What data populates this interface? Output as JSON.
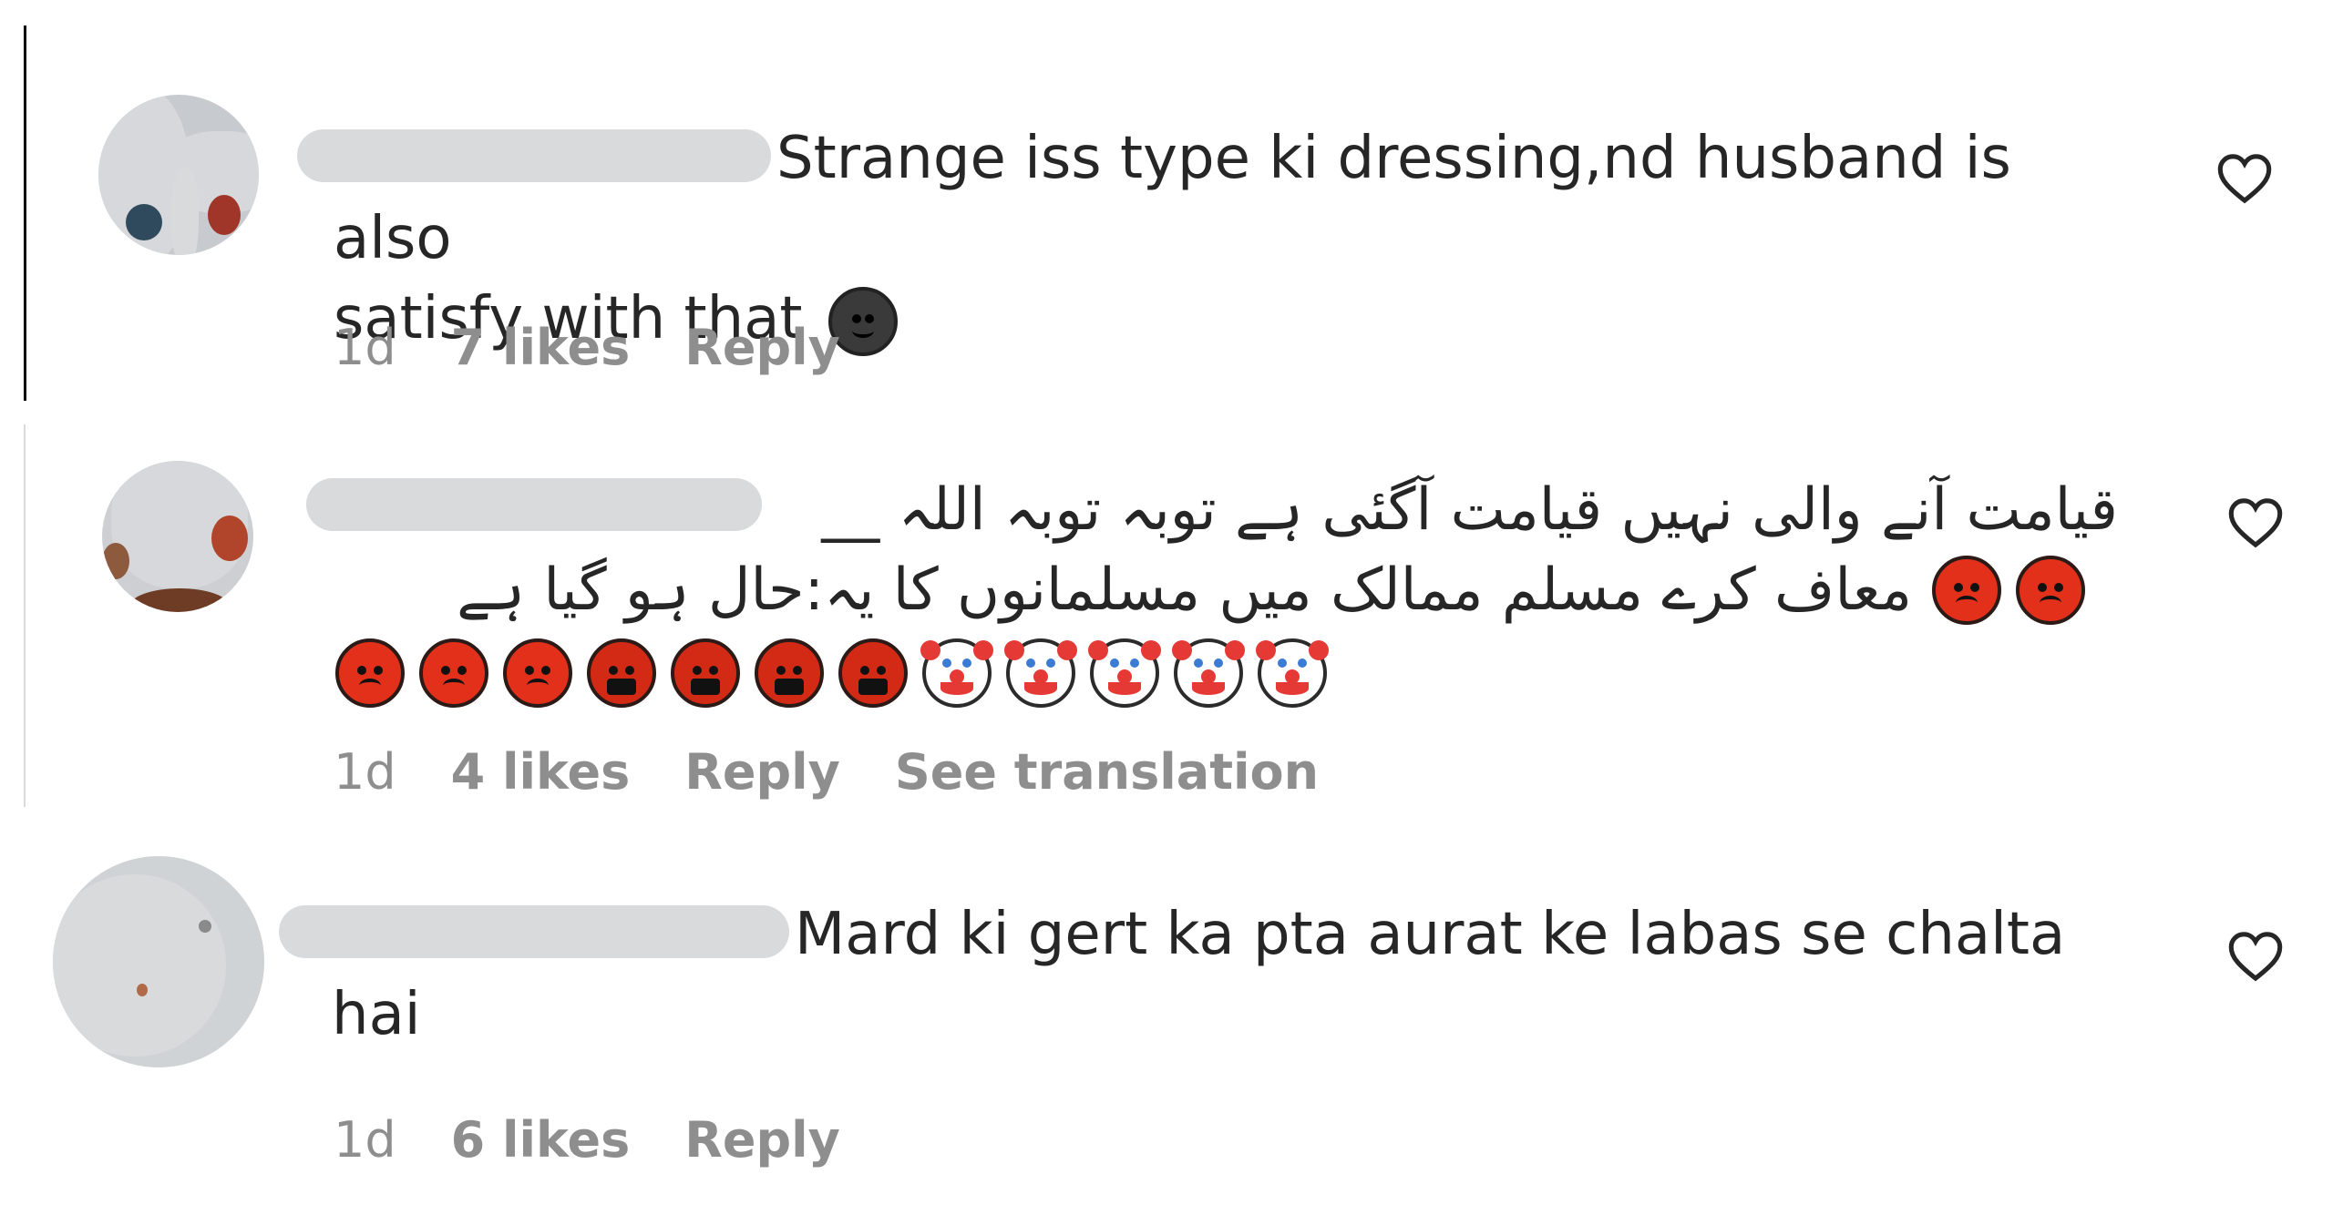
{
  "comments": [
    {
      "text": "Strange iss type ki dressing,nd husband is also",
      "text_line2": "satisfy with that",
      "time": "1d",
      "likes": "7 likes",
      "reply": "Reply"
    },
    {
      "text": "قیامت آنے والی نہیں قیامت آگئی ہے توبہ توبہ اللہ __",
      "text_line2": "معاف کرے مسلم ممالک میں مسلمانوں کا یہ:حال ہو گیا ہے",
      "time": "1d",
      "likes": "4 likes",
      "reply": "Reply",
      "see_translation": "See translation"
    },
    {
      "text": "Mard ki gert ka pta aurat ke labas se chalta",
      "text_line2": "hai",
      "time": "1d",
      "likes": "6 likes",
      "reply": "Reply"
    }
  ],
  "colors": {
    "text": "#262626",
    "meta": "#8e8e8e",
    "thread_line": "#000000",
    "username_mask": "#d9dadc"
  },
  "icons": {
    "like": "heart-outline-icon",
    "emoji_1": "smiling-face-emoji",
    "emoji_2": "angry-face-emoji",
    "emoji_3": "cursing-face-emoji",
    "emoji_4": "clown-face-emoji"
  }
}
